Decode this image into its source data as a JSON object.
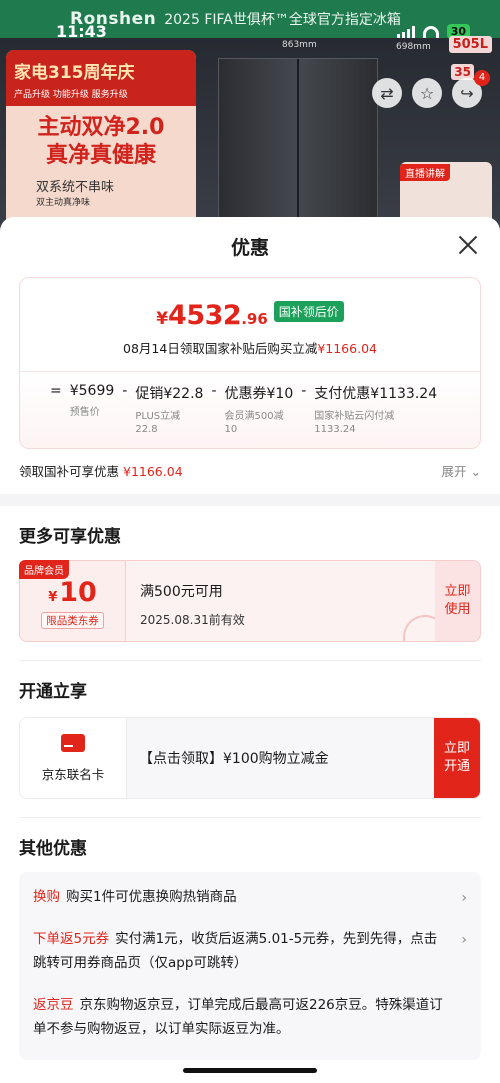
{
  "background": {
    "status_time": "11:43",
    "battery": "30",
    "brand": "Ronshen",
    "banner_text": "2025 FIFA世俱杯™全球官方指定冰箱",
    "promo_title_top": "家电315周年庆",
    "promo_tags": "产品升级  功能升级  服务升级",
    "promo_headline": "主动双净2.0\n真净真健康",
    "promo_sub": "双系统不串味",
    "promo_sub2": "双主动真净味",
    "fridge_width": "863mm",
    "fridge_depth": "698mm",
    "capacity": "505L",
    "capacity2": "35",
    "cart_count": "4",
    "live_tag": "直播讲解"
  },
  "sheet": {
    "title": "优惠",
    "price": {
      "yen": "¥",
      "integer": "4532",
      "decimal": ".96",
      "tag": "国补领后价",
      "note_prefix": "08月14日领取国家补贴后购买立减",
      "note_amount": "¥1166.04"
    },
    "formula": [
      {
        "main": "¥5699",
        "sub": "预售价"
      },
      {
        "op": "-"
      },
      {
        "main": "促销¥22.8",
        "sub": "PLUS立减\n22.8"
      },
      {
        "op": "-"
      },
      {
        "main": "优惠券¥10",
        "sub": "会员满500减\n10"
      },
      {
        "op": "-"
      },
      {
        "main": "支付优惠¥1133.24",
        "sub": "国家补贴云闪付减\n1133.24"
      }
    ],
    "formula_eq": "=",
    "subsidy": {
      "label": "领取国补可享优惠",
      "amount": "¥1166.04",
      "expand": "展开 ⌄"
    },
    "more_title": "更多可享优惠",
    "coupon": {
      "badge": "品牌会员",
      "yen": "¥",
      "amount": "10",
      "scope": "限品类东券",
      "condition": "满500元可用",
      "valid": "2025.08.31前有效",
      "button": "立即使用"
    },
    "open_title": "开通立享",
    "card_offer": {
      "name": "京东联名卡",
      "text": "【点击领取】¥100购物立减金",
      "button": "立即开通"
    },
    "other_title": "其他优惠",
    "other_items": [
      {
        "tag": "换购",
        "text": "购买1件可优惠换购热销商品",
        "arrow": "›"
      },
      {
        "tag": "下单返5元券",
        "text": "实付满1元，收货后返满5.01-5元券，先到先得，点击跳转可用券商品页（仅app可跳转）",
        "arrow": "›"
      },
      {
        "tag": "返京豆",
        "text": "京东购物返京豆，订单完成后最高可返226京豆。特殊渠道订单不参与购物返豆，以订单实际返豆为准。",
        "arrow": ""
      }
    ]
  },
  "colors": {
    "accent_red": "#e1251b",
    "tag_green": "#1ba15a",
    "banner_green": "#1f7a4d"
  },
  "icons": [
    "close-icon",
    "chevron-right-icon",
    "chevron-down-icon",
    "card-icon",
    "favorite-icon",
    "share-icon",
    "compare-icon"
  ]
}
